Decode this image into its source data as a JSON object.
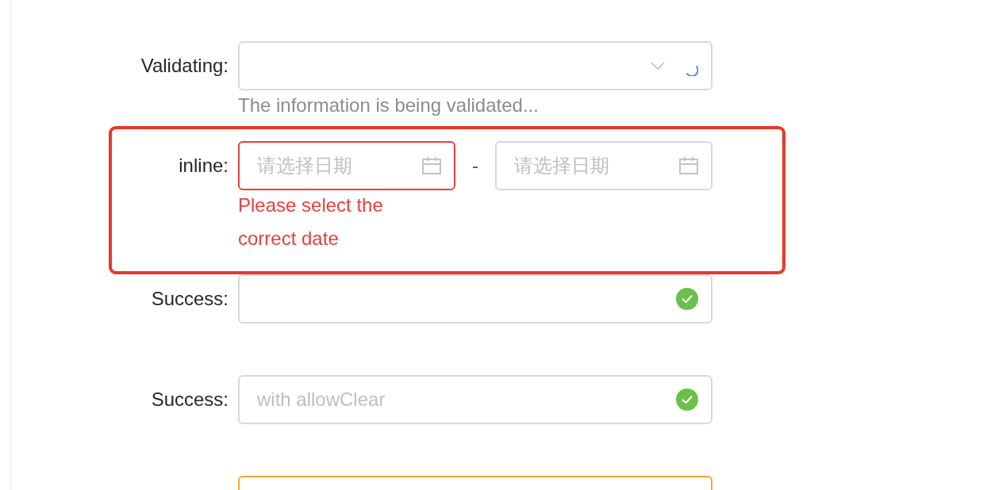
{
  "form": {
    "items": [
      {
        "label": "Validating:",
        "kind": "validating",
        "highlighted": false,
        "help": "The information is being validated..."
      },
      {
        "label": "inline:",
        "kind": "error",
        "highlighted": true,
        "start": {
          "placeholder": "请选择日期",
          "invalid": true
        },
        "separator": "-",
        "end": {
          "placeholder": "请选择日期",
          "invalid": false
        },
        "help": "Please select the correct date"
      },
      {
        "label": "Success:",
        "kind": "success",
        "highlighted": false
      },
      {
        "label": "Success:",
        "kind": "success",
        "highlighted": false,
        "placeholder": "with allowClear"
      },
      {
        "kind": "warning",
        "highlighted": false
      }
    ]
  }
}
